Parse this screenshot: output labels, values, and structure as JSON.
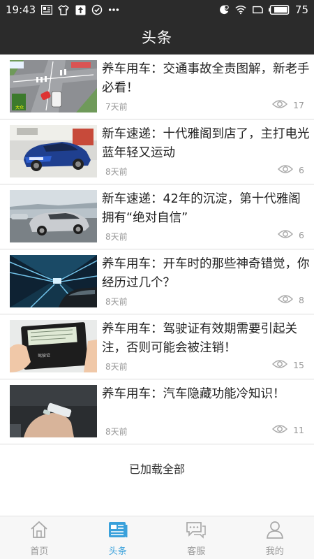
{
  "status_bar": {
    "time": "19:43",
    "battery": "75"
  },
  "header": {
    "title": "头条"
  },
  "articles": [
    {
      "title": "养车用车：交通事故全责图解，新老手必看！",
      "time": "7天前",
      "views": "17"
    },
    {
      "title": "新车速递：十代雅阁到店了，主打电光蓝年轻又运动",
      "time": "8天前",
      "views": "6"
    },
    {
      "title": "新车速递：42年的沉淀，第十代雅阁拥有“绝对自信”",
      "time": "8天前",
      "views": "6"
    },
    {
      "title": "养车用车：开车时的那些神奇错觉，你经历过几个？",
      "time": "8天前",
      "views": "8"
    },
    {
      "title": "养车用车：驾驶证有效期需要引起关注，否则可能会被注销！",
      "time": "8天前",
      "views": "15"
    },
    {
      "title": "养车用车：汽车隐藏功能冷知识！",
      "time": "8天前",
      "views": "11"
    }
  ],
  "footer_text": "已加载全部",
  "tabs": [
    {
      "label": "首页",
      "icon": "home-icon"
    },
    {
      "label": "头条",
      "icon": "news-icon"
    },
    {
      "label": "客服",
      "icon": "chat-icon"
    },
    {
      "label": "我的",
      "icon": "user-icon"
    }
  ],
  "active_tab": "头条",
  "colors": {
    "header_bg": "#2b2b2b",
    "accent": "#3aa1db",
    "muted": "#999999"
  }
}
